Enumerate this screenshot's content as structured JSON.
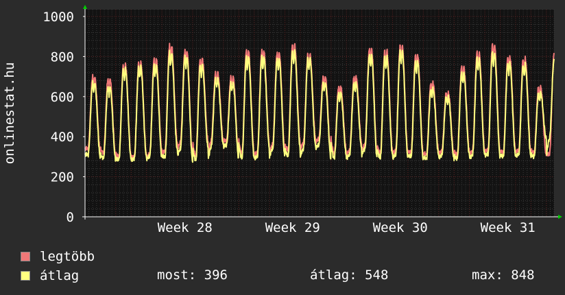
{
  "chart_data": {
    "type": "line",
    "ylabel": "onlinestat.hu",
    "ylim": [
      0,
      1000
    ],
    "yticks": [
      0,
      200,
      400,
      600,
      800,
      1000
    ],
    "xticks": [
      {
        "label": "Week 28",
        "day": 6.5
      },
      {
        "label": "Week 29",
        "day": 13.5
      },
      {
        "label": "Week 30",
        "day": 20.5
      },
      {
        "label": "Week 31",
        "day": 27.5
      }
    ],
    "xlim_days": [
      0,
      30.5
    ],
    "grid": true,
    "colors": {
      "background": "#2b2b2b",
      "plot_background": "#121212",
      "legtobb": "#f07878",
      "atlag": "#ffff80",
      "axis": "#ffffff",
      "arrow": "#00cc00",
      "grid_major": "#5a2020",
      "grid_minor": "#3a3a3a"
    },
    "series": [
      {
        "name": "legtöbb",
        "daily_peaks": [
          700,
          690,
          760,
          770,
          790,
          855,
          830,
          790,
          720,
          700,
          830,
          830,
          820,
          860,
          810,
          700,
          650,
          700,
          840,
          830,
          855,
          810,
          670,
          620,
          750,
          820,
          860,
          800,
          790,
          650,
          810
        ],
        "daily_troughs": [
          340,
          320,
          300,
          300,
          310,
          330,
          370,
          300,
          380,
          380,
          310,
          320,
          360,
          330,
          370,
          390,
          310,
          330,
          360,
          310,
          330,
          320,
          310,
          330,
          310,
          330,
          330,
          320,
          330,
          320,
          310
        ]
      },
      {
        "name": "átlag",
        "daily_peaks": [
          670,
          650,
          740,
          750,
          760,
          820,
          800,
          760,
          690,
          670,
          800,
          800,
          790,
          830,
          790,
          670,
          620,
          670,
          810,
          800,
          830,
          780,
          640,
          600,
          720,
          790,
          820,
          770,
          760,
          620,
          780
        ],
        "daily_troughs": [
          310,
          295,
          285,
          290,
          300,
          300,
          340,
          280,
          350,
          360,
          290,
          300,
          340,
          300,
          340,
          360,
          290,
          310,
          340,
          290,
          310,
          300,
          290,
          310,
          290,
          310,
          310,
          300,
          310,
          300,
          390
        ]
      }
    ]
  },
  "legend": {
    "max_label": "legtöbb",
    "avg_label": "átlag"
  },
  "stats": {
    "current": "most: 396",
    "average": "átlag: 548",
    "maximum": "max: 848"
  }
}
